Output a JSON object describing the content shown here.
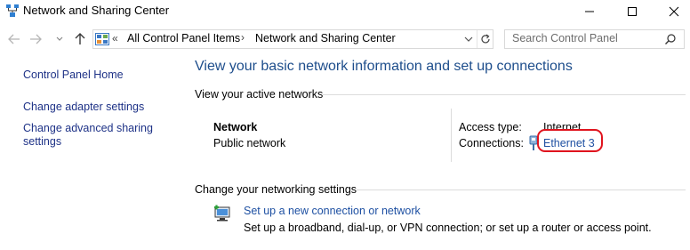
{
  "window": {
    "title": "Network and Sharing Center"
  },
  "address_bar": {
    "overflow_chevron": "«",
    "breadcrumbs": [
      "All Control Panel Items",
      "Network and Sharing Center"
    ],
    "separator": "›"
  },
  "search": {
    "placeholder": "Search Control Panel"
  },
  "sidebar": {
    "items": [
      {
        "label": "Control Panel Home"
      },
      {
        "label": "Change adapter settings"
      },
      {
        "label": "Change advanced sharing settings"
      }
    ]
  },
  "main": {
    "heading": "View your basic network information and set up connections",
    "active_networks": {
      "section_title": "View your active networks",
      "network_name": "Network",
      "network_category": "Public network",
      "access_type_label": "Access type:",
      "access_type_value": "Internet",
      "connections_label": "Connections:",
      "connection_name": "Ethernet 3"
    },
    "change_settings": {
      "section_title": "Change your networking settings",
      "setup_link": "Set up a new connection or network",
      "setup_description": "Set up a broadband, dial-up, or VPN connection; or set up a router or access point."
    }
  },
  "colors": {
    "heading": "#1e4e8c",
    "link": "#1e50a2",
    "highlight": "#e0141e"
  }
}
